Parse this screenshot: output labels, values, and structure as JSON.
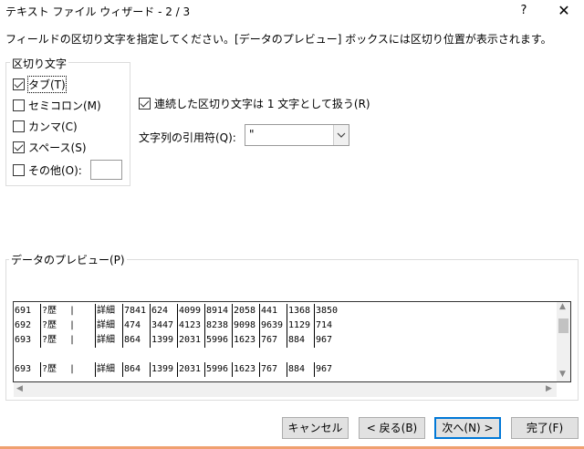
{
  "window": {
    "title": "テキスト ファイル ウィザード - 2 / 3",
    "help_label": "?",
    "close_label": "✕"
  },
  "instruction": "フィールドの区切り文字を指定してください。[データのプレビュー] ボックスには区切り位置が表示されます。",
  "delimiters": {
    "legend": "区切り文字",
    "tab": {
      "label": "タブ(T)",
      "checked": true
    },
    "semicolon": {
      "label": "セミコロン(M)",
      "checked": false
    },
    "comma": {
      "label": "カンマ(C)",
      "checked": false
    },
    "space": {
      "label": "スペース(S)",
      "checked": true
    },
    "other": {
      "label": "その他(O):",
      "checked": false,
      "value": ""
    }
  },
  "consecutive": {
    "label": "連続した区切り文字は 1 文字として扱う(R)",
    "checked": true
  },
  "text_qualifier": {
    "label": "文字列の引用符(Q):",
    "value": "\""
  },
  "preview": {
    "legend": "データのプレビュー(P)",
    "rows": [
      [
        "691",
        "?歴",
        "|",
        "詳細",
        "7841",
        "624",
        "4099",
        "8914",
        "2058",
        "441",
        "1368",
        "3850"
      ],
      [
        "692",
        "?歴",
        "|",
        "詳細",
        "474",
        "3447",
        "4123",
        "8238",
        "9098",
        "9639",
        "1129",
        "714"
      ],
      [
        "693",
        "?歴",
        "|",
        "詳細",
        "864",
        "1399",
        "2031",
        "5996",
        "1623",
        "767",
        "884",
        "967"
      ],
      [],
      [
        "693",
        "?歴",
        "|",
        "詳細",
        "864",
        "1399",
        "2031",
        "5996",
        "1623",
        "767",
        "884",
        "967"
      ]
    ]
  },
  "buttons": {
    "cancel": "キャンセル",
    "back": "< 戻る(B)",
    "next": "次へ(N) >",
    "finish": "完了(F)"
  },
  "colors": {
    "default_button_border": "#0078d7"
  }
}
